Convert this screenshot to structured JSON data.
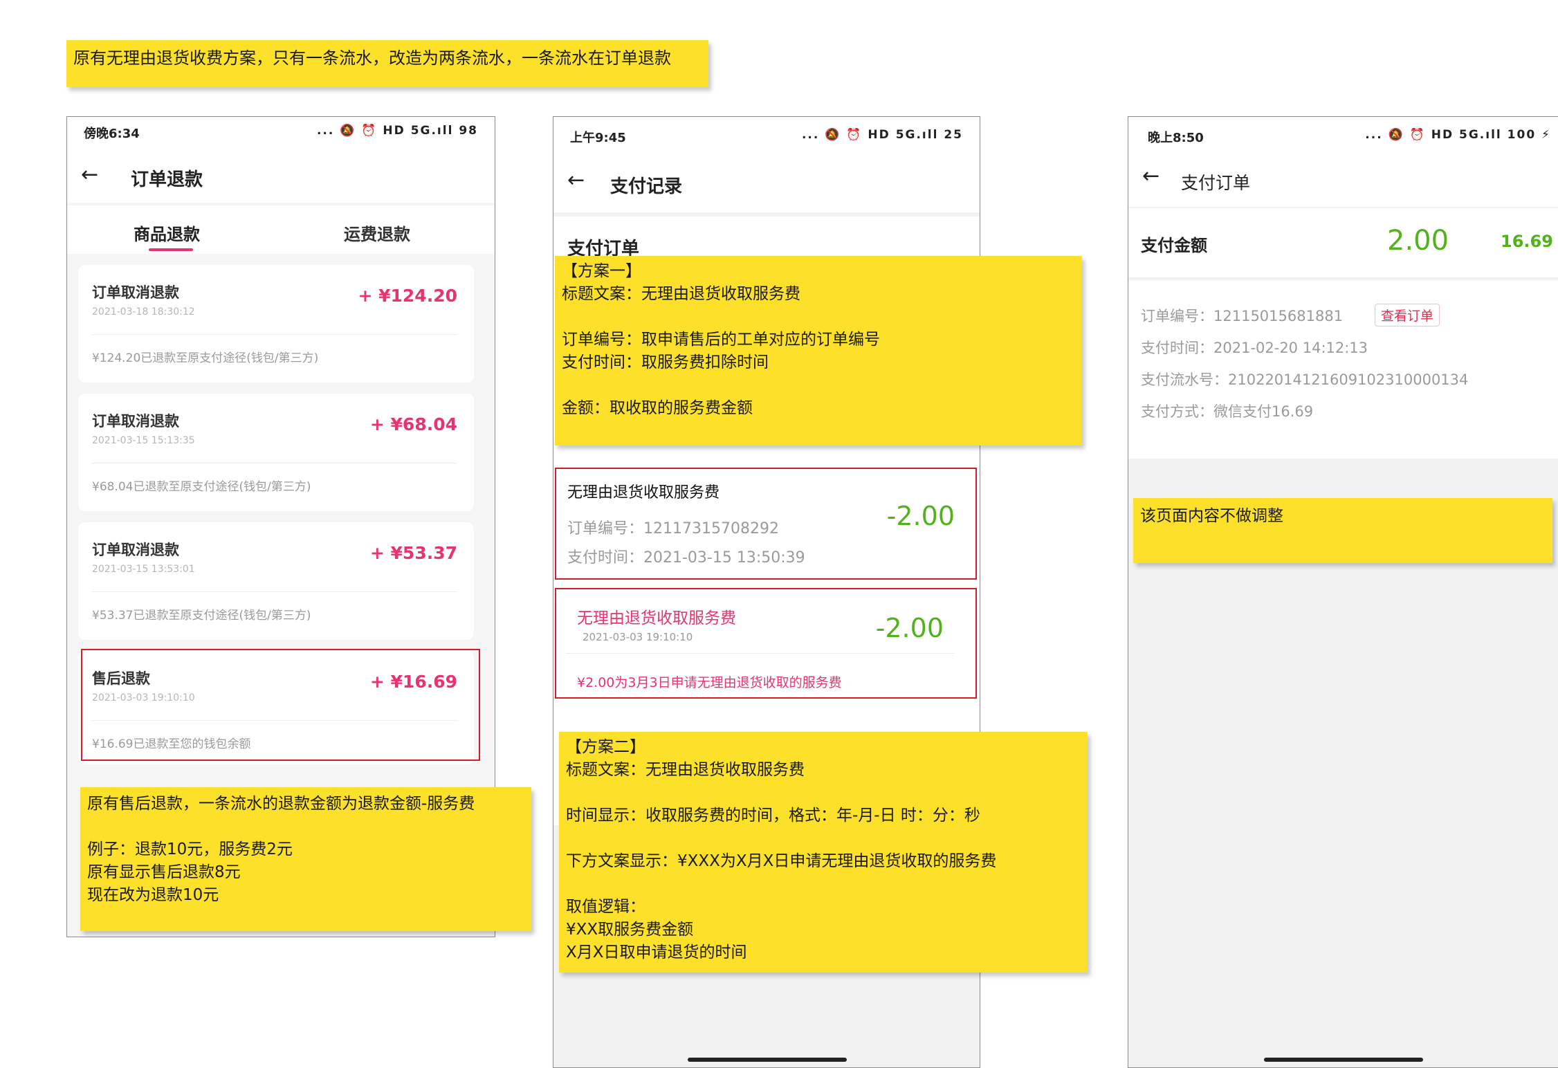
{
  "top_note": "原有无理由退货收费方案，只有一条流水，改造为两条流水，一条流水在订单退款",
  "phone1": {
    "status_time": "傍晚6:34",
    "status_icons": "... 🔕 ⏰ HD 5G.ıll 98",
    "title": "订单退款",
    "tabs": [
      "商品退款",
      "运费退款"
    ],
    "items": [
      {
        "title": "订单取消退款",
        "date": "2021-03-18 18:30:12",
        "amount": "+ ¥124.20",
        "note": "¥124.20已退款至原支付途径(钱包/第三方)"
      },
      {
        "title": "订单取消退款",
        "date": "2021-03-15 15:13:35",
        "amount": "+ ¥68.04",
        "note": "¥68.04已退款至原支付途径(钱包/第三方)"
      },
      {
        "title": "订单取消退款",
        "date": "2021-03-15 13:53:01",
        "amount": "+ ¥53.37",
        "note": "¥53.37已退款至原支付途径(钱包/第三方)"
      },
      {
        "title": "售后退款",
        "date": "2021-03-03 19:10:10",
        "amount": "+ ¥16.69",
        "note": "¥16.69已退款至您的钱包余额"
      }
    ],
    "note_lines": [
      "原有售后退款，一条流水的退款金额为退款金额-服务费",
      "",
      "例子：退款10元，服务费2元",
      "原有显示售后退款8元",
      "现在改为退款10元"
    ]
  },
  "phone2": {
    "status_time": "上午9:45",
    "status_icons": "... 🔕 ⏰ HD 5G.ıll 25",
    "title": "支付记录",
    "section_title": "支付订单",
    "plan1_lines": [
      "【方案一】",
      "标题文案：无理由退货收取服务费",
      "",
      "订单编号：取申请售后的工单对应的订单编号",
      "支付时间：取服务费扣除时间",
      "",
      "金额：取收取的服务费金额"
    ],
    "record1": {
      "title": "无理由退货收取服务费",
      "order_no": "订单编号：12117315708292",
      "pay_time": "支付时间：2021-03-15 13:50:39",
      "amount": "-2.00"
    },
    "record2": {
      "title": "无理由退货收取服务费",
      "date": "2021-03-03 19:10:10",
      "amount": "-2.00",
      "note": "¥2.00为3月3日申请无理由退货收取的服务费"
    },
    "plan2_lines": [
      "【方案二】",
      "标题文案：无理由退货收取服务费",
      "",
      "时间显示：收取服务费的时间，格式：年-月-日 时：分：秒",
      "",
      "下方文案显示：¥XXX为X月X日申请无理由退货收取的服务费",
      "",
      "取值逻辑：",
      "¥XX取服务费金额",
      "X月X日取申请退货的时间"
    ]
  },
  "phone3": {
    "status_time": "晚上8:50",
    "status_icons": "... 🔕 ⏰ HD 5G.ıll 100 ⚡",
    "title": "支付订单",
    "amount_label": "支付金额",
    "amount": "2.00",
    "amount_side": "16.69",
    "order_no": "订单编号：12115015681881",
    "view_order": "查看订单",
    "pay_time": "支付时间：2021-02-20 14:12:13",
    "serial_no": "支付流水号：21022014121609102310000134",
    "pay_method": "支付方式：微信支付16.69",
    "note": "该页面内容不做调整"
  },
  "colors": {
    "pink": "#e8336e",
    "green": "#52b21a",
    "sticky": "#fde02a",
    "frame": "#d41e2c"
  }
}
